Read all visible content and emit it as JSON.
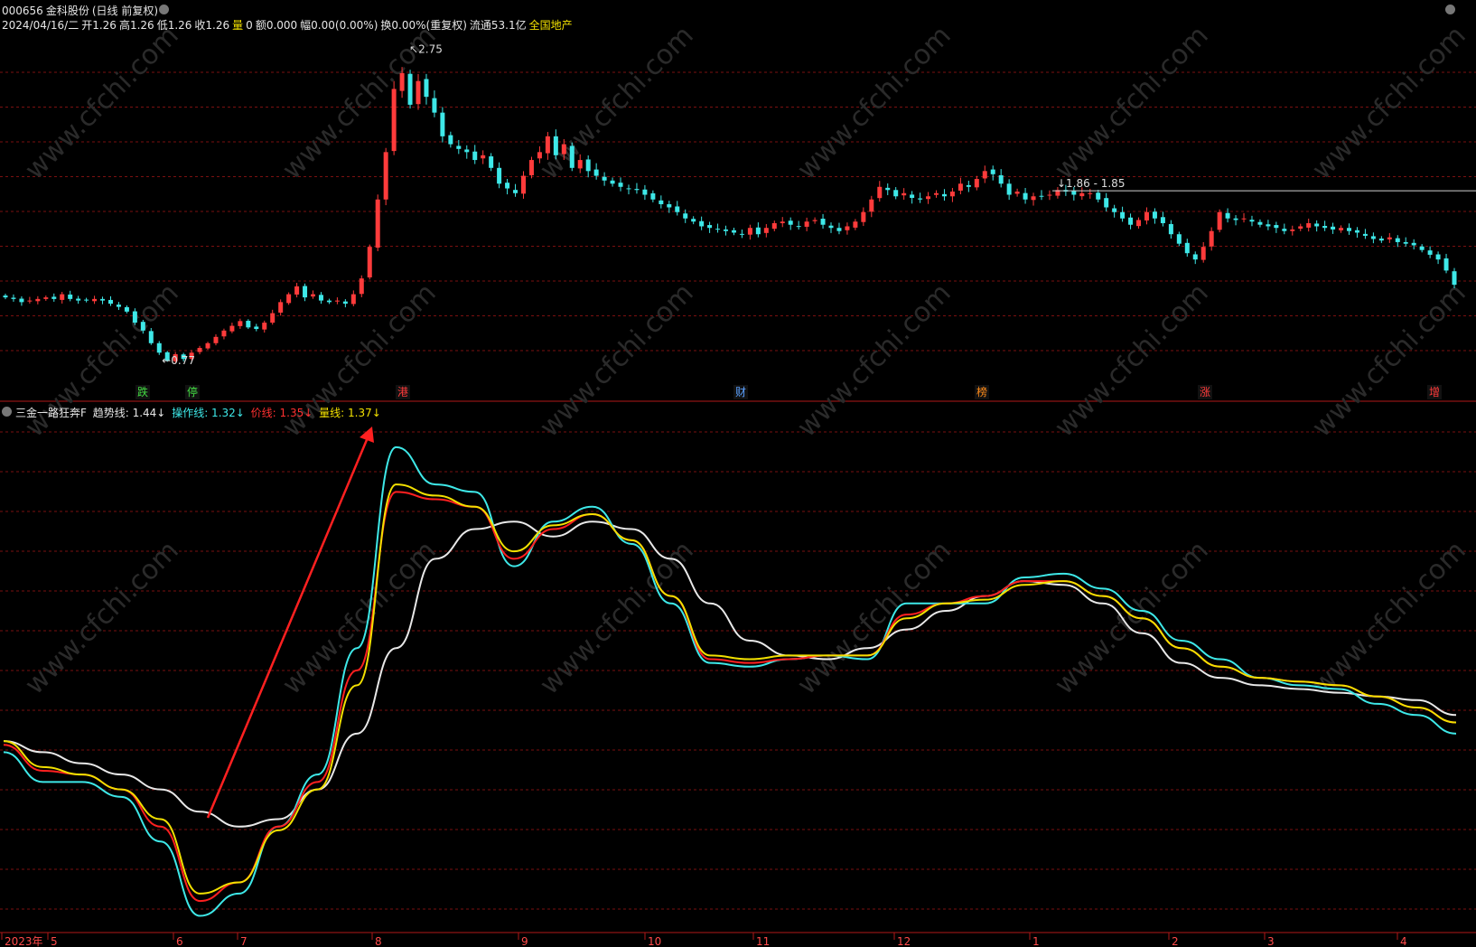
{
  "header": {
    "code": "000656",
    "name": "金科股份",
    "period": "(日线 前复权)",
    "date": "2024/04/16/二",
    "open": "开1.26",
    "high": "高1.26",
    "low": "低1.26",
    "close": "收1.26",
    "vol_label": "量",
    "vol": "0",
    "amount": "额0.000",
    "change": "幅0.00(0.00%)",
    "turnover": "换0.00%(重复权)",
    "float_cap": "流通53.1亿",
    "sector": "全国地产"
  },
  "indicator": {
    "name": "三金一路狂奔F",
    "trend": "趋势线: 1.44↓",
    "operate": "操作线: 1.32↓",
    "price": "价线: 1.35↓",
    "volume": "量线: 1.37↓"
  },
  "annotations": {
    "high_label": "2.75",
    "low_label": "0.77",
    "level_label": "1.86 - 1.85"
  },
  "colors": {
    "up": "#ff3b3b",
    "down": "#3ee8e8",
    "grid": "#7a1010",
    "trend": "#e8e8e8",
    "operate": "#3ee8e8",
    "price": "#ff2020",
    "volume": "#f2e000",
    "arrow": "#ff2020"
  },
  "chart_data": [
    {
      "type": "candlestick",
      "series": [
        {
          "name": "000656",
          "closes": [
            1.18,
            1.17,
            1.15,
            1.16,
            1.17,
            1.18,
            1.17,
            1.2,
            1.17,
            1.16,
            1.16,
            1.17,
            1.16,
            1.14,
            1.12,
            1.09,
            1.02,
            0.97,
            0.89,
            0.83,
            0.78,
            0.82,
            0.79,
            0.83,
            0.86,
            0.89,
            0.93,
            0.97,
            1.0,
            1.03,
            0.99,
            0.98,
            1.02,
            1.08,
            1.15,
            1.2,
            1.25,
            1.18,
            1.2,
            1.16,
            1.15,
            1.16,
            1.14,
            1.2,
            1.3,
            1.5,
            1.8,
            2.1,
            2.5,
            2.6,
            2.4,
            2.55,
            2.45,
            2.35,
            2.2,
            2.15,
            2.12,
            2.1,
            2.05,
            2.08,
            2.0,
            1.9,
            1.87,
            1.84,
            1.95,
            2.05,
            2.1,
            2.2,
            2.08,
            2.15,
            2.0,
            2.05,
            1.98,
            1.95,
            1.92,
            1.9,
            1.88,
            1.87,
            1.86,
            1.83,
            1.8,
            1.77,
            1.75,
            1.72,
            1.68,
            1.66,
            1.63,
            1.62,
            1.61,
            1.6,
            1.59,
            1.58,
            1.62,
            1.58,
            1.62,
            1.65,
            1.66,
            1.64,
            1.63,
            1.66,
            1.67,
            1.64,
            1.62,
            1.6,
            1.63,
            1.66,
            1.72,
            1.8,
            1.88,
            1.86,
            1.82,
            1.84,
            1.81,
            1.8,
            1.82,
            1.84,
            1.82,
            1.85,
            1.9,
            1.88,
            1.93,
            1.98,
            1.96,
            1.9,
            1.83,
            1.85,
            1.8,
            1.82,
            1.82,
            1.83,
            1.86,
            1.85,
            1.83,
            1.84,
            1.84,
            1.8,
            1.75,
            1.72,
            1.68,
            1.64,
            1.67,
            1.72,
            1.68,
            1.65,
            1.58,
            1.52,
            1.46,
            1.42,
            1.5,
            1.6,
            1.72,
            1.68,
            1.67,
            1.68,
            1.66,
            1.64,
            1.63,
            1.62,
            1.6,
            1.61,
            1.63,
            1.65,
            1.63,
            1.62,
            1.61,
            1.62,
            1.6,
            1.59,
            1.57,
            1.55,
            1.54,
            1.56,
            1.53,
            1.52,
            1.51,
            1.48,
            1.45,
            1.42,
            1.35,
            1.26
          ]
        }
      ],
      "high": 2.75,
      "low": 0.77,
      "level": "1.86 - 1.85",
      "markers": [
        "跌",
        "停",
        "港",
        "财",
        "榜",
        "涨",
        "增"
      ]
    },
    {
      "type": "line",
      "title": "三金一路狂奔F",
      "x": [
        "2023年",
        "5",
        "6",
        "7",
        "8",
        "9",
        "10",
        "11",
        "12",
        "1",
        "2",
        "3",
        "4"
      ],
      "series": [
        {
          "name": "趋势线",
          "last": 1.44,
          "values": [
            0.93,
            0.9,
            0.87,
            0.84,
            0.8,
            0.74,
            0.7,
            0.72,
            0.8,
            0.95,
            1.18,
            1.42,
            1.5,
            1.52,
            1.48,
            1.52,
            1.5,
            1.42,
            1.3,
            1.2,
            1.16,
            1.15,
            1.18,
            1.23,
            1.28,
            1.32,
            1.36,
            1.35,
            1.3,
            1.22,
            1.14,
            1.1,
            1.08,
            1.07,
            1.06,
            1.05,
            1.04,
            1.0
          ]
        },
        {
          "name": "操作线",
          "last": 1.32,
          "values": [
            0.9,
            0.82,
            0.82,
            0.78,
            0.66,
            0.46,
            0.52,
            0.7,
            0.84,
            1.18,
            1.72,
            1.62,
            1.6,
            1.4,
            1.52,
            1.56,
            1.46,
            1.3,
            1.14,
            1.13,
            1.15,
            1.16,
            1.15,
            1.3,
            1.3,
            1.3,
            1.37,
            1.38,
            1.34,
            1.28,
            1.2,
            1.15,
            1.1,
            1.08,
            1.07,
            1.03,
            1.0,
            0.95
          ]
        },
        {
          "name": "价线",
          "last": 1.35,
          "values": [
            0.92,
            0.85,
            0.84,
            0.8,
            0.7,
            0.5,
            0.55,
            0.7,
            0.82,
            1.12,
            1.6,
            1.58,
            1.56,
            1.42,
            1.5,
            1.54,
            1.47,
            1.32,
            1.15,
            1.14,
            1.15,
            1.16,
            1.16,
            1.27,
            1.3,
            1.32,
            1.36,
            1.36,
            1.32,
            1.26,
            1.18,
            1.13,
            1.1,
            1.09,
            1.08,
            1.05,
            1.02,
            0.98
          ]
        },
        {
          "name": "量线",
          "last": 1.37,
          "values": [
            0.93,
            0.86,
            0.84,
            0.8,
            0.72,
            0.52,
            0.55,
            0.69,
            0.8,
            1.08,
            1.62,
            1.59,
            1.56,
            1.44,
            1.51,
            1.54,
            1.47,
            1.32,
            1.16,
            1.15,
            1.16,
            1.16,
            1.16,
            1.26,
            1.3,
            1.31,
            1.35,
            1.36,
            1.32,
            1.26,
            1.18,
            1.13,
            1.1,
            1.09,
            1.08,
            1.05,
            1.02,
            0.98
          ]
        }
      ]
    }
  ]
}
